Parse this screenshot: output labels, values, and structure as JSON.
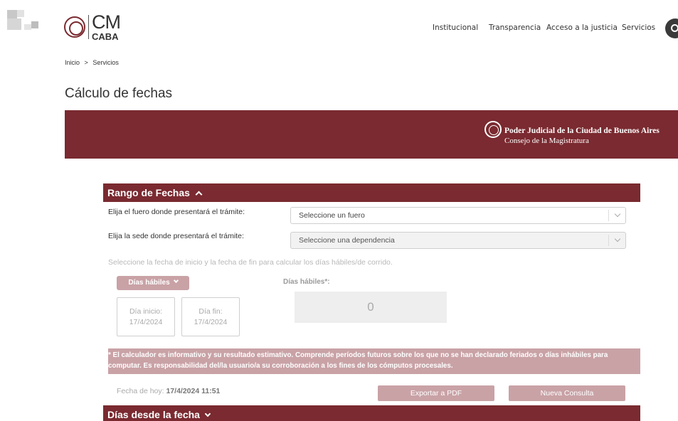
{
  "header": {
    "logo_cm": "CM",
    "logo_caba": "CABA",
    "nav": [
      "Institucional",
      "Transparencia",
      "Acceso a la justicia",
      "Servicios"
    ]
  },
  "breadcrumb": {
    "home": "Inicio",
    "separator": ">",
    "current": "Servicios"
  },
  "page_title": "Cálculo de fechas",
  "banner": {
    "title": "Poder Judicial de la Ciudad de Buenos Aires",
    "subtitle": "Consejo de la Magistratura"
  },
  "rango": {
    "section_title": "Rango de Fechas",
    "fuero_label": "Elija el fuero donde presentará el trámite:",
    "fuero_value": "Seleccione un fuero",
    "sede_label": "Elija la sede donde presentará el trámite:",
    "sede_value": "Seleccione una dependencia",
    "hint": "Seleccione la fecha de inicio y la fecha de fin para calcular los días hábiles/de corrido.",
    "mode_button": "Días hábiles",
    "result_label": "Días hábiles*:",
    "result_value": "0",
    "start_label": "Día inicio:",
    "start_value": "17/4/2024",
    "end_label": "Día fin:",
    "end_value": "17/4/2024",
    "disclaimer": "* El calculador es informativo y su resultado estimativo. Comprende períodos futuros sobre los que no se han declarado feriados o días inhábiles para computar. Es responsabilidad del/la usuario/a su corroboración a los fines de los cómputos procesales.",
    "today_label": "Fecha de hoy:",
    "today_value": "17/4/2024 11:51",
    "export_button": "Exportar a PDF",
    "new_button": "Nueva Consulta"
  },
  "desde": {
    "section_title": "Días desde la fecha"
  },
  "colors": {
    "brand": "#7a2a30",
    "brand_light": "#c9a2a6"
  }
}
